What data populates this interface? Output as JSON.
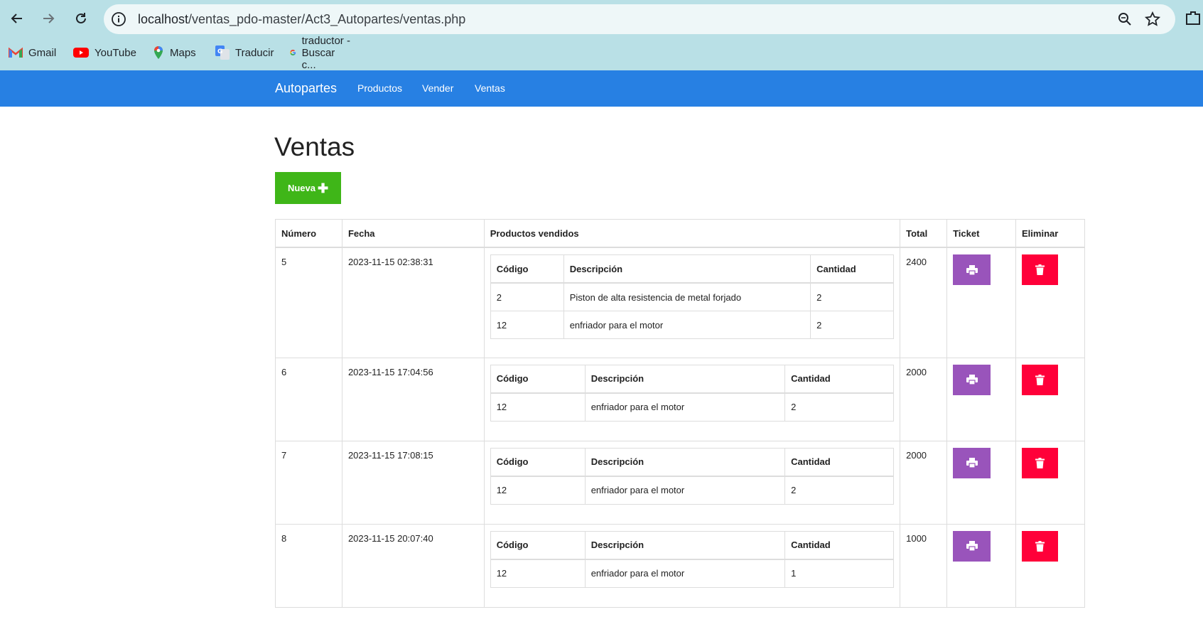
{
  "browser": {
    "url_host": "localhost",
    "url_path": "/ventas_pdo-master/Act3_Autopartes/ventas.php",
    "bookmarks": [
      {
        "label": "Gmail",
        "icon": "gmail-icon"
      },
      {
        "label": "YouTube",
        "icon": "youtube-icon"
      },
      {
        "label": "Maps",
        "icon": "maps-icon"
      },
      {
        "label": "Traducir",
        "icon": "translate-icon"
      },
      {
        "label": "traductor - Buscar c...",
        "icon": "google-icon"
      }
    ]
  },
  "navbar": {
    "brand": "Autopartes",
    "links": [
      "Productos",
      "Vender",
      "Ventas"
    ],
    "color": "#2780e3"
  },
  "page": {
    "title": "Ventas",
    "new_button": "Nueva"
  },
  "table": {
    "headers": [
      "Número",
      "Fecha",
      "Productos vendidos",
      "Total",
      "Ticket",
      "Eliminar"
    ],
    "inner_headers": [
      "Código",
      "Descripción",
      "Cantidad"
    ],
    "rows": [
      {
        "numero": "5",
        "fecha": "2023-11-15 02:38:31",
        "total": "2400",
        "productos": [
          {
            "codigo": "2",
            "descripcion": "Piston de alta resistencia de metal forjado",
            "cantidad": "2"
          },
          {
            "codigo": "12",
            "descripcion": "enfriador para el motor",
            "cantidad": "2"
          }
        ]
      },
      {
        "numero": "6",
        "fecha": "2023-11-15 17:04:56",
        "total": "2000",
        "productos": [
          {
            "codigo": "12",
            "descripcion": "enfriador para el motor",
            "cantidad": "2"
          }
        ]
      },
      {
        "numero": "7",
        "fecha": "2023-11-15 17:08:15",
        "total": "2000",
        "productos": [
          {
            "codigo": "12",
            "descripcion": "enfriador para el motor",
            "cantidad": "2"
          }
        ]
      },
      {
        "numero": "8",
        "fecha": "2023-11-15 20:07:40",
        "total": "1000",
        "productos": [
          {
            "codigo": "12",
            "descripcion": "enfriador para el motor",
            "cantidad": "1"
          }
        ]
      }
    ]
  },
  "colors": {
    "new_button": "#3fb618",
    "ticket_button": "#9954bb",
    "delete_button": "#ff0039"
  }
}
